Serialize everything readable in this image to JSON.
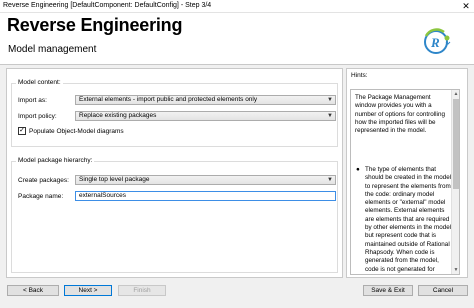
{
  "window": {
    "title": "Reverse Engineering [DefaultComponent: DefaultConfig] - Step 3/4",
    "close": "✕"
  },
  "header": {
    "title": "Reverse Engineering",
    "subtitle": "Model management"
  },
  "model_content": {
    "legend": "Model content:",
    "import_as_label": "Import as:",
    "import_as_value": "External elements - import public and protected elements only",
    "import_policy_label": "Import policy:",
    "import_policy_value": "Replace existing packages",
    "populate_label": "Populate Object-Model diagrams",
    "populate_checked": true
  },
  "package_hierarchy": {
    "legend": "Model package hierarchy:",
    "create_packages_label": "Create packages:",
    "create_packages_value": "Single top level package",
    "package_name_label": "Package name:",
    "package_name_value": "externalSources"
  },
  "hints": {
    "title": "Hints:",
    "intro": "The Package Management window provides you with a number of options for controlling how the imported files will be represented in the model.",
    "bullet": "The type of elements that should be created in the model to represent the elements from the code: ordinary model elements or \"external\" model elements. External elements are elements that are required by other elements in the model, but represent code that is maintained outside of Rational Rhapsody. When code is generated from the model, code is not generated for external"
  },
  "buttons": {
    "back": "< Back",
    "next": "Next >",
    "finish": "Finish",
    "save_exit": "Save & Exit",
    "cancel": "Cancel"
  },
  "colors": {
    "focus_border": "#3d8ee6",
    "logo_blue": "#2e86c9",
    "logo_green": "#8cc63f"
  }
}
